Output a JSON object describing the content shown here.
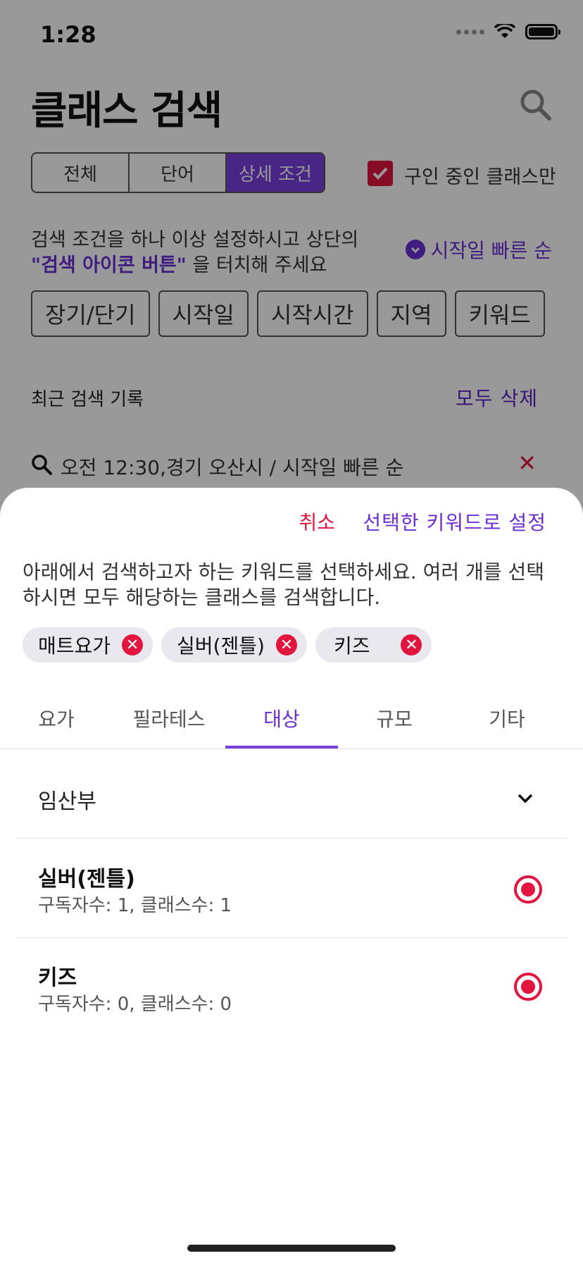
{
  "status_bar": {
    "time": "1:28"
  },
  "header": {
    "title": "클래스 검색"
  },
  "segments": [
    "전체",
    "단어",
    "상세 조건"
  ],
  "only_buying_label": "구인 중인 클래스만",
  "guide": {
    "line1": "검색 조건을 하나 이상 설정하시고 상단의",
    "highlight": "\"검색 아이콘 버튼\"",
    "line2_rest": " 을 터치해 주세요"
  },
  "sort_label": "시작일 빠른 순",
  "filter_chips": [
    "장기/단기",
    "시작일",
    "시작시간",
    "지역",
    "키워드"
  ],
  "recent": {
    "label": "최근 검색 기록",
    "delete_all": "모두 삭제",
    "item": "오전 12:30,경기 오산시 / 시작일 빠른 순"
  },
  "sheet": {
    "cancel": "취소",
    "set_keyword": "선택한 키워드로 설정",
    "instruction": "아래에서 검색하고자 하는 키워드를 선택하세요. 여러 개를 선택하시면 모두 해당하는 클래스를 검색합니다.",
    "selected_chips": [
      "매트요가",
      "실버(젠틀)",
      "키즈"
    ],
    "tabs": [
      "요가",
      "필라테스",
      "대상",
      "규모",
      "기타"
    ],
    "active_tab": "대상",
    "section_label": "임산부",
    "items": [
      {
        "title": "실버(젠틀)",
        "sub": "구독자수: 1, 클래스수: 1"
      },
      {
        "title": "키즈",
        "sub": "구독자수: 0, 클래스수: 0"
      }
    ]
  },
  "colors": {
    "accent_purple": "#6a2fd4",
    "accent_red": "#e0163e"
  }
}
